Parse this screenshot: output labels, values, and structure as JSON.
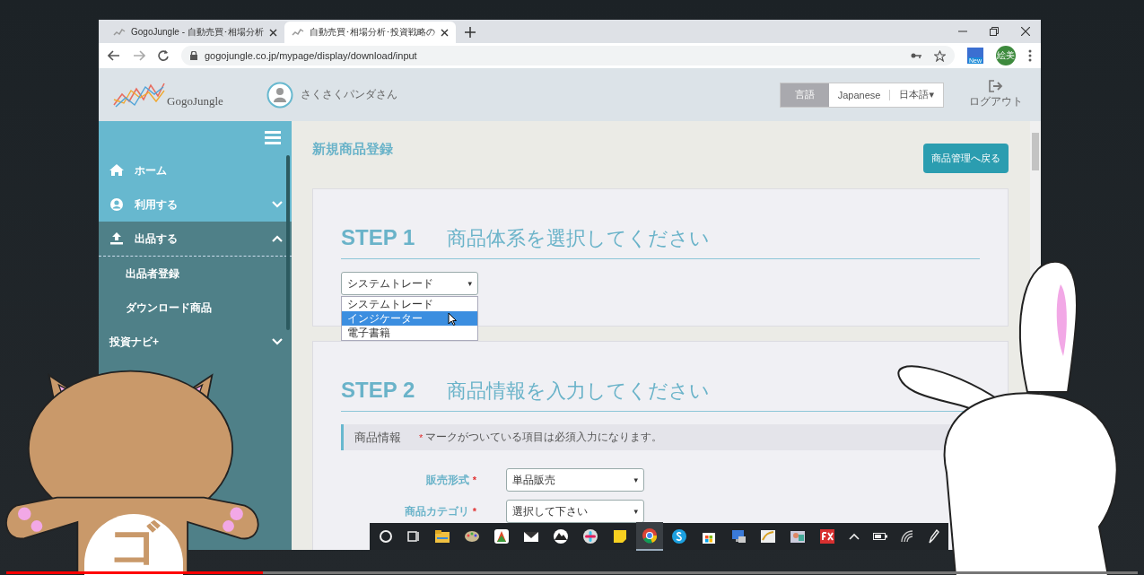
{
  "browser": {
    "tabs": [
      {
        "title": "GogoJungle - 自動売買･相場分析",
        "selected": false
      },
      {
        "title": "自動売買･相場分析･投資戦略の",
        "selected": true
      }
    ],
    "url": "gogojungle.co.jp/mypage/display/download/input",
    "extension_badge": "New",
    "profile_initials": "絵美"
  },
  "site_header": {
    "logo": "GogoJungle",
    "user_name": "さくさくパンダさん",
    "language_label": "言語",
    "languages": [
      "Japanese",
      "日本語▾"
    ],
    "logout": "ログアウト"
  },
  "sidebar": {
    "items": [
      {
        "label": "ホーム",
        "kind": "home",
        "expanded": false
      },
      {
        "label": "利用する",
        "kind": "user",
        "expanded": false
      },
      {
        "label": "出品する",
        "kind": "upload",
        "expanded": true,
        "children": [
          {
            "label": "出品者登録"
          },
          {
            "label": "ダウンロード商品"
          }
        ]
      },
      {
        "label": "投資ナビ+",
        "kind": "none",
        "expanded": false
      }
    ]
  },
  "page_title": "新規商品登録",
  "back_button": "商品管理へ戻る",
  "step1": {
    "step": "STEP 1",
    "title": "商品体系を選択してください",
    "select_value": "システムトレード",
    "caret": "▾",
    "options": [
      {
        "label": "システムトレード",
        "selected": false
      },
      {
        "label": "インジケーター",
        "selected": true
      },
      {
        "label": "電子書籍",
        "selected": false
      }
    ]
  },
  "step2": {
    "step": "STEP 2",
    "title": "商品情報を入力してください",
    "section_label": "商品情報",
    "required_mark": "*",
    "note": "マークがついている項目は必須入力になります。",
    "fields": [
      {
        "label": "販売形式",
        "required": true,
        "value": "単品販売",
        "caret": "▾"
      },
      {
        "label": "商品カテゴリ",
        "required": true,
        "value": "選択して下さい",
        "caret": "▾"
      }
    ]
  },
  "mascot_badge": "ゴ",
  "video": {
    "level": 0.227
  }
}
